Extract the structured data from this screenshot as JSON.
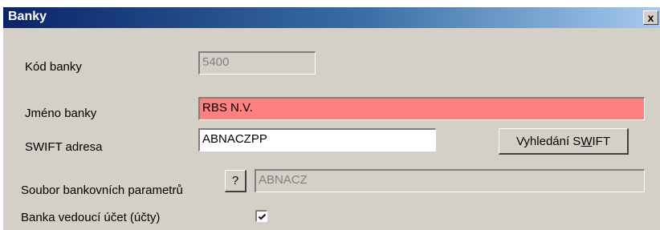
{
  "window": {
    "title": "Banky",
    "close_label": "x"
  },
  "form": {
    "bank_code": {
      "label": "Kód banky",
      "value": "5400"
    },
    "bank_name": {
      "label": "Jméno banky",
      "value": "RBS N.V."
    },
    "swift_address": {
      "label": "SWIFT adresa",
      "value": "ABNACZPP"
    },
    "swift_lookup_button": {
      "label_prefix": "Vyhledání S",
      "label_mnemonic": "W",
      "label_suffix": "IFT"
    },
    "bank_params_file": {
      "label": "Soubor bankovních parametrů",
      "help_button_label": "?",
      "value": "ABNACZ"
    },
    "account_bank": {
      "label": "Banka vedoucí účet (účty)",
      "checked": true
    }
  }
}
